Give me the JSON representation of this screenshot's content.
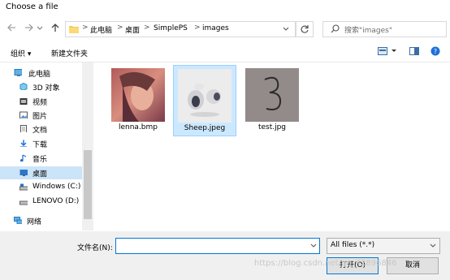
{
  "window": {
    "title": "Choose a file"
  },
  "nav": {
    "back_icon": "arrow-left-icon",
    "forward_icon": "arrow-right-icon",
    "dropdown_icon": "chevron-down-icon",
    "up_icon": "arrow-up-icon"
  },
  "address": {
    "breadcrumbs": [
      "此电脑",
      "桌面",
      "SimplePS",
      "images"
    ],
    "separator": ">",
    "refresh_icon": "refresh-icon"
  },
  "search": {
    "placeholder": "搜索\"images\""
  },
  "toolbar": {
    "organize": "组织 ▾",
    "new_folder": "新建文件夹"
  },
  "sidebar": {
    "items": [
      {
        "label": "此电脑",
        "icon": "computer-icon"
      },
      {
        "label": "3D 对象",
        "icon": "3d-objects-icon"
      },
      {
        "label": "视频",
        "icon": "video-icon"
      },
      {
        "label": "图片",
        "icon": "pictures-icon"
      },
      {
        "label": "文档",
        "icon": "documents-icon"
      },
      {
        "label": "下载",
        "icon": "download-icon"
      },
      {
        "label": "音乐",
        "icon": "music-icon"
      },
      {
        "label": "桌面",
        "icon": "desktop-icon"
      },
      {
        "label": "Windows (C:)",
        "icon": "drive-icon"
      },
      {
        "label": "LENOVO (D:)",
        "icon": "drive-icon"
      },
      {
        "label": "网络",
        "icon": "network-icon"
      }
    ]
  },
  "files": [
    {
      "name": "lenna.bmp",
      "selected": false
    },
    {
      "name": "Sheep.jpeg",
      "selected": true
    },
    {
      "name": "test.jpg",
      "selected": false
    }
  ],
  "footer": {
    "filename_label": "文件名(N):",
    "filename_value": "",
    "filetype_value": "All files (*.*)",
    "open_label": "打开(O)",
    "cancel_label": "取消"
  },
  "watermark": "https://blog.csdn.net/qq_42896846",
  "colors": {
    "selection": "#cce4f7",
    "accent": "#0078d7"
  }
}
